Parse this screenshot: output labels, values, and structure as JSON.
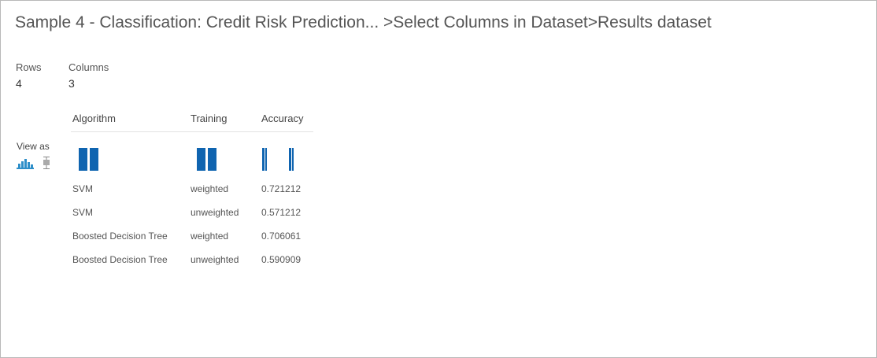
{
  "title": "Sample 4 - Classification: Credit Risk Prediction... >Select Columns in Dataset>Results dataset",
  "stats": {
    "rows_label": "Rows",
    "rows_value": "4",
    "columns_label": "Columns",
    "columns_value": "3"
  },
  "view_as": {
    "label": "View as",
    "options": [
      "histogram-icon",
      "boxplot-icon"
    ]
  },
  "accent_color": "#0f64b0",
  "table": {
    "columns": [
      "Algorithm",
      "Training",
      "Accuracy"
    ],
    "rows": [
      [
        "SVM",
        "weighted",
        "0.721212"
      ],
      [
        "SVM",
        "unweighted",
        "0.571212"
      ],
      [
        "Boosted Decision Tree",
        "weighted",
        "0.706061"
      ],
      [
        "Boosted Decision Tree",
        "unweighted",
        "0.590909"
      ]
    ]
  }
}
